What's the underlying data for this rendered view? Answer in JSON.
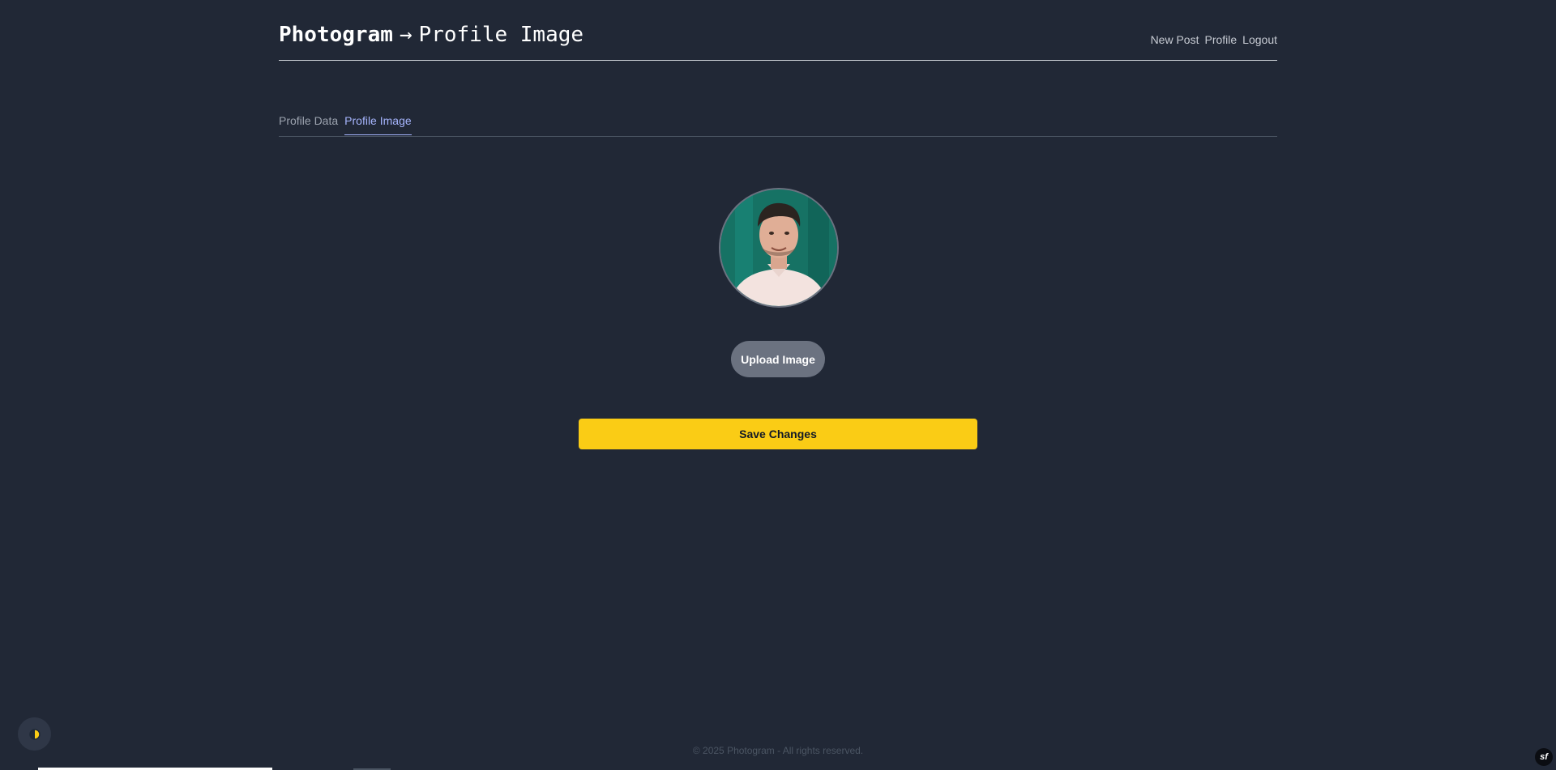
{
  "header": {
    "brand": "Photogram",
    "separator": "→",
    "section": "Profile Image",
    "nav": [
      "New Post",
      "Profile",
      "Logout"
    ]
  },
  "tabs": [
    {
      "label": "Profile Data",
      "active": false
    },
    {
      "label": "Profile Image",
      "active": true
    }
  ],
  "profile": {
    "avatar_icon": "user-avatar-photo"
  },
  "actions": {
    "upload_label": "Upload Image",
    "save_label": "Save Changes"
  },
  "footer": {
    "text": "© 2025 Photogram - All rights reserved."
  },
  "colors": {
    "background": "#212836",
    "accent_tab": "#a5b4fc",
    "save_button": "#facc15",
    "upload_button": "#6b7280"
  },
  "icons": {
    "theme_toggle": "half-moon-icon",
    "symfony_toolbar": "symfony-icon"
  }
}
